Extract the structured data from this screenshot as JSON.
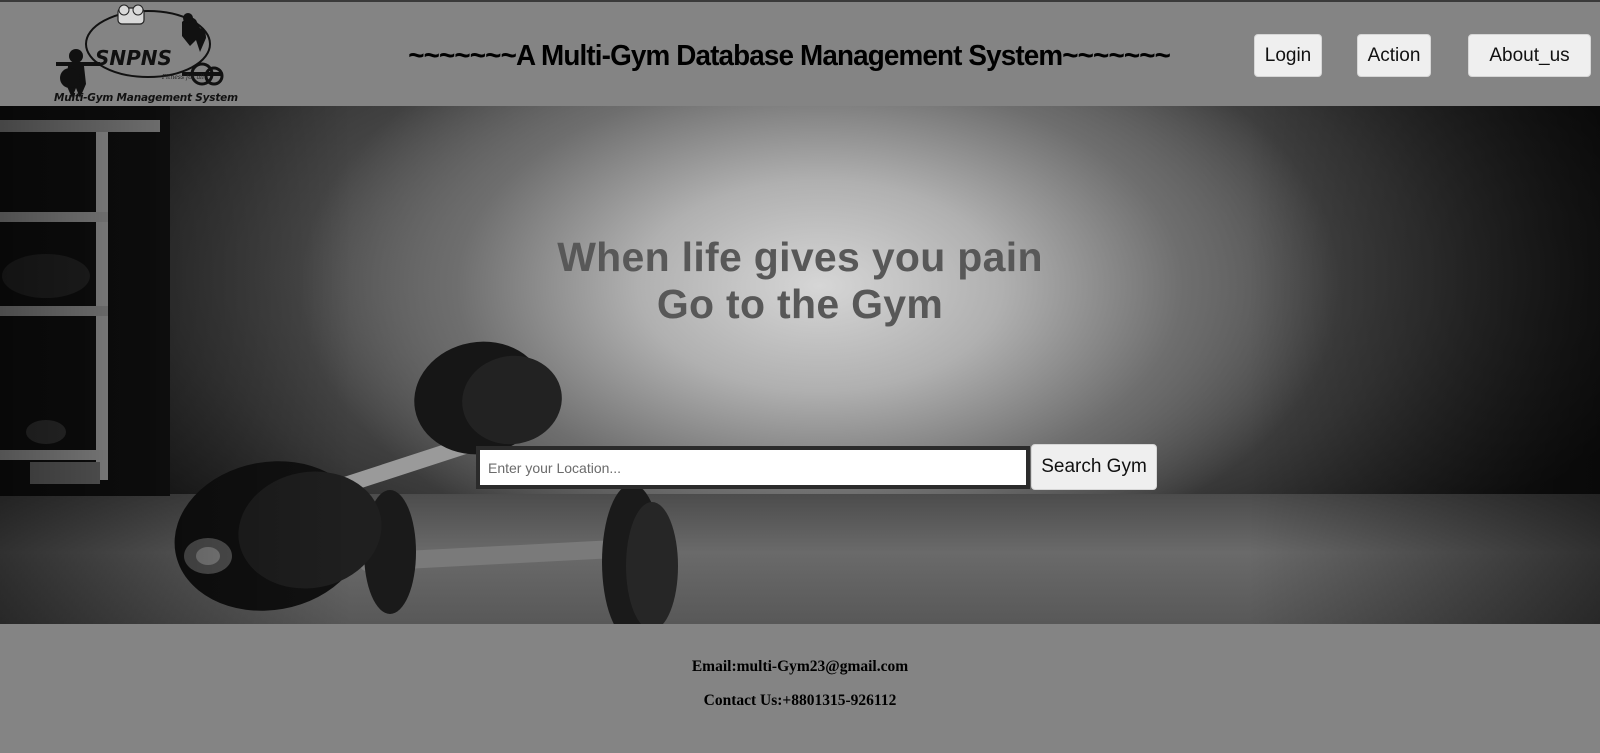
{
  "header": {
    "logo": {
      "brand": "SNPNS",
      "tagline": "Fitness for all",
      "caption": "Multi-Gym Management System",
      "icon": "gym-logo-icon"
    },
    "title": "~~~~~~~A Multi-Gym Database Management System~~~~~~~",
    "nav": {
      "login": "Login",
      "action": "Action",
      "about": "About_us"
    }
  },
  "hero": {
    "heading_line1": "When life gives you pain",
    "heading_line2": "Go to the Gym",
    "background_icon": "dumbbells-photo",
    "search": {
      "placeholder": "Enter your Location...",
      "value": "",
      "button_label": "Search Gym"
    }
  },
  "footer": {
    "email": "Email:multi-Gym23@gmail.com",
    "contact": "Contact Us:+8801315-926112"
  },
  "colors": {
    "header_bg": "#848484",
    "footer_bg": "#848484",
    "heading_text": "#585858",
    "button_bg": "#efefef"
  }
}
